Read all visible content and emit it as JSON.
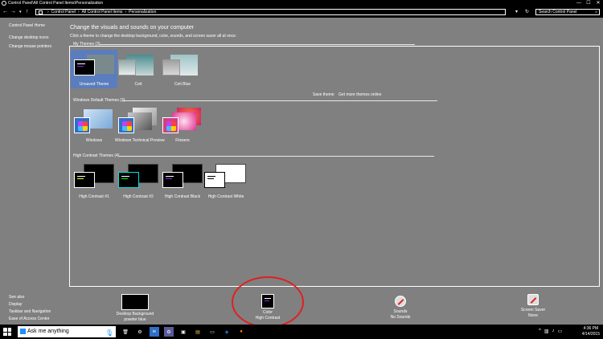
{
  "window": {
    "title": "Control Panel\\All Control Panel Items\\Personalization",
    "minimize": "—",
    "maximize": "☐",
    "close": "✕"
  },
  "address": {
    "crumbs": [
      "Control Panel",
      "All Control Panel Items",
      "Personalization"
    ],
    "search_placeholder": "Search Control Panel"
  },
  "leftnav": {
    "home": "Control Panel Home",
    "items": [
      "Change desktop icons",
      "Change mouse pointers"
    ],
    "see_also": "See also",
    "see_also_items": [
      "Display",
      "Taskbar and Navigation",
      "Ease of Access Center"
    ]
  },
  "main": {
    "heading": "Change the visuals and sounds on your computer",
    "subheading": "Click a theme to change the desktop background, color, sounds, and screen saver all at once.",
    "my_themes_header": "My Themes (3)",
    "my_themes": [
      "Unsaved Theme",
      "Ceti",
      "Ceti Blue"
    ],
    "save_theme": "Save theme",
    "get_more": "Get more themes online",
    "default_header": "Windows Default Themes (3)",
    "default_themes": [
      "Windows",
      "Windows Technical Preview",
      "Flowers"
    ],
    "hc_header": "High Contrast Themes (4)",
    "hc_themes": [
      "High Contrast #1",
      "High Contrast #2",
      "High Contrast Black",
      "High Contrast White"
    ]
  },
  "bottom": {
    "desktop_bg": "Desktop Background",
    "desktop_bg_value": "powder blue",
    "color": "Color",
    "color_value": "High Contrast",
    "sounds": "Sounds",
    "sounds_value": "No Sounds",
    "screensaver": "Screen Saver",
    "screensaver_value": "None"
  },
  "taskbar": {
    "search_text": "Ask me anything",
    "time": "4:36 PM",
    "date": "4/14/2015",
    "highlight_color": "#e02020"
  }
}
